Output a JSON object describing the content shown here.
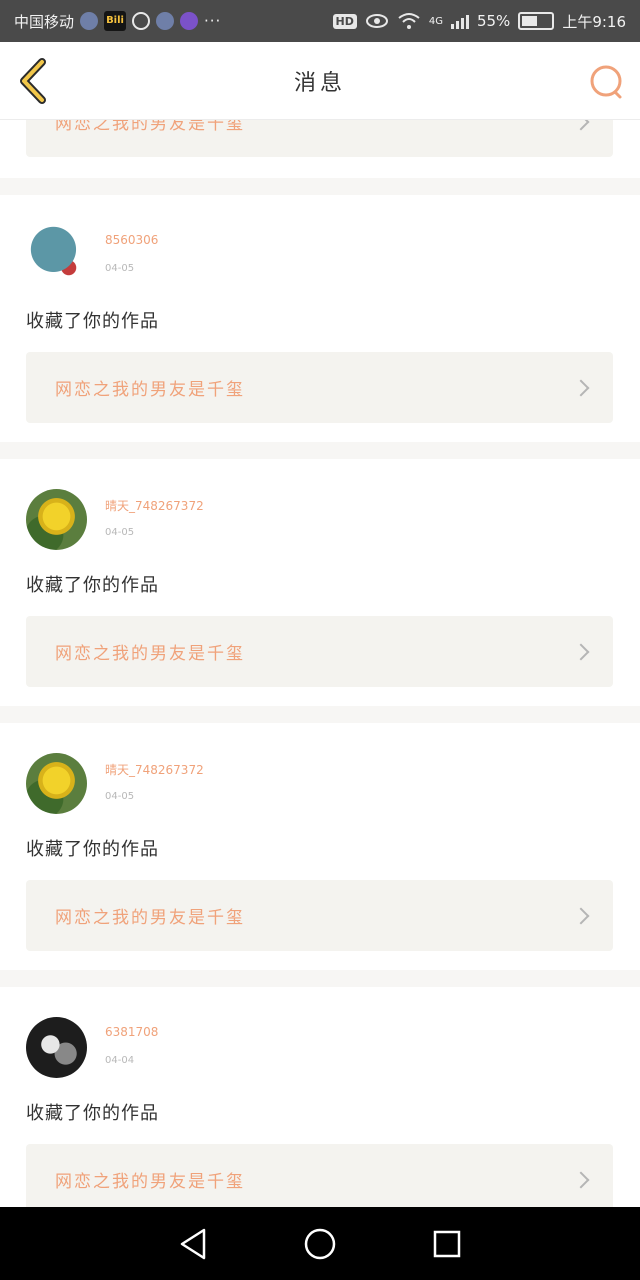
{
  "status_bar": {
    "carrier": "中国移动",
    "network": "4G",
    "hd": "HD",
    "battery_text": "55%",
    "battery_level": 0.55,
    "time": "上午9:16",
    "bilibili_label": "Bili",
    "more": "···"
  },
  "header": {
    "title": "消息",
    "accent_color": "#f0a27a"
  },
  "previous_card": {
    "work_title": "网恋之我的男友是千玺"
  },
  "notifications": [
    {
      "username": "8560306",
      "date": "04-05",
      "action": "收藏了你的作品",
      "work_title": "网恋之我的男友是千玺",
      "avatar": "dino-avatar"
    },
    {
      "username": "晴天_748267372",
      "date": "04-05",
      "action": "收藏了你的作品",
      "work_title": "网恋之我的男友是千玺",
      "avatar": "flower-avatar"
    },
    {
      "username": "晴天_748267372",
      "date": "04-05",
      "action": "收藏了你的作品",
      "work_title": "网恋之我的男友是千玺",
      "avatar": "flower-avatar"
    },
    {
      "username": "6381708",
      "date": "04-04",
      "action": "收藏了你的作品",
      "work_title": "网恋之我的男友是千玺",
      "avatar": "dark-avatar"
    }
  ]
}
